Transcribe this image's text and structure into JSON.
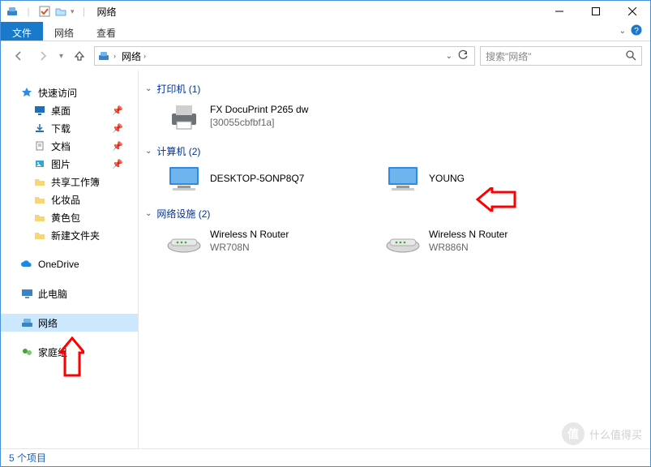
{
  "window": {
    "title": "网络",
    "minimize_tip": "Minimize",
    "maximize_tip": "Maximize",
    "close_tip": "Close"
  },
  "ribbon": {
    "file": "文件",
    "tabs": [
      "网络",
      "查看"
    ]
  },
  "nav": {
    "breadcrumb": [
      "网络"
    ],
    "search_placeholder": "搜索\"网络\""
  },
  "sidebar": {
    "quick_access": "快速访问",
    "items": [
      "桌面",
      "下载",
      "文档",
      "图片",
      "共享工作簿",
      "化妆品",
      "黄色包",
      "新建文件夹"
    ],
    "pinned_count": 4,
    "onedrive": "OneDrive",
    "this_pc": "此电脑",
    "network": "网络",
    "homegroup": "家庭组"
  },
  "groups": [
    {
      "title": "打印机 (1)",
      "kind": "printer",
      "items": [
        {
          "line1": "FX DocuPrint P265 dw",
          "line2": "[30055cbfbf1a]"
        }
      ]
    },
    {
      "title": "计算机 (2)",
      "kind": "computer",
      "items": [
        {
          "line1": "DESKTOP-5ONP8Q7",
          "line2": ""
        },
        {
          "line1": "YOUNG",
          "line2": ""
        }
      ]
    },
    {
      "title": "网络设施 (2)",
      "kind": "router",
      "items": [
        {
          "line1": "Wireless N Router",
          "line2": "WR708N"
        },
        {
          "line1": "Wireless N Router",
          "line2": "WR886N"
        }
      ]
    }
  ],
  "status": {
    "text": "5 个项目"
  },
  "watermark": "什么值得买",
  "colors": {
    "accent": "#1979ca",
    "link": "#003399"
  }
}
